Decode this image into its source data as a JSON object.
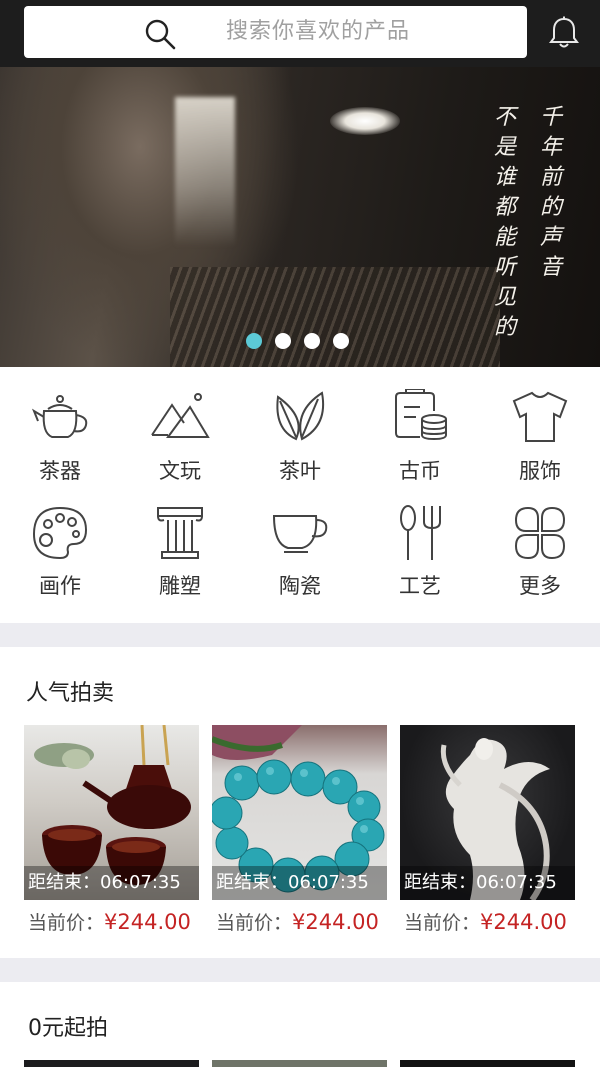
{
  "search": {
    "placeholder": "搜索你喜欢的产品"
  },
  "icons": {
    "search": "search-icon",
    "notification": "bell-icon"
  },
  "banner": {
    "poem_right": "千年前的声音",
    "poem_left": "不是谁都能听见的",
    "slides_total": 4,
    "active_slide": 1,
    "active_dot_color": "#5cc9d6"
  },
  "categories": [
    {
      "label": "茶器",
      "icon": "teapot-icon"
    },
    {
      "label": "文玩",
      "icon": "mountain-icon"
    },
    {
      "label": "茶叶",
      "icon": "tea-leaf-icon"
    },
    {
      "label": "古币",
      "icon": "coins-icon"
    },
    {
      "label": "服饰",
      "icon": "tshirt-icon"
    },
    {
      "label": "画作",
      "icon": "palette-icon"
    },
    {
      "label": "雕塑",
      "icon": "column-icon"
    },
    {
      "label": "陶瓷",
      "icon": "cup-icon"
    },
    {
      "label": "工艺",
      "icon": "cutlery-icon"
    },
    {
      "label": "更多",
      "icon": "more-clover-icon"
    }
  ],
  "popular_auction": {
    "title": "人气拍卖",
    "items": [
      {
        "timer": "距结束：06:07:35",
        "price_label": "当前价：",
        "price": "¥244.00",
        "image": "tea-set"
      },
      {
        "timer": "距结束：06:07:35",
        "price_label": "当前价：",
        "price": "¥244.00",
        "image": "turquoise-bracelet"
      },
      {
        "timer": "距结束：06:07:35",
        "price_label": "当前价：",
        "price": "¥244.00",
        "image": "white-porcelain-statue"
      }
    ]
  },
  "zero_start": {
    "title": "0元起拍"
  },
  "colors": {
    "price": "#c42323",
    "topbar": "#1d1d1d",
    "separator": "#ececf1"
  }
}
